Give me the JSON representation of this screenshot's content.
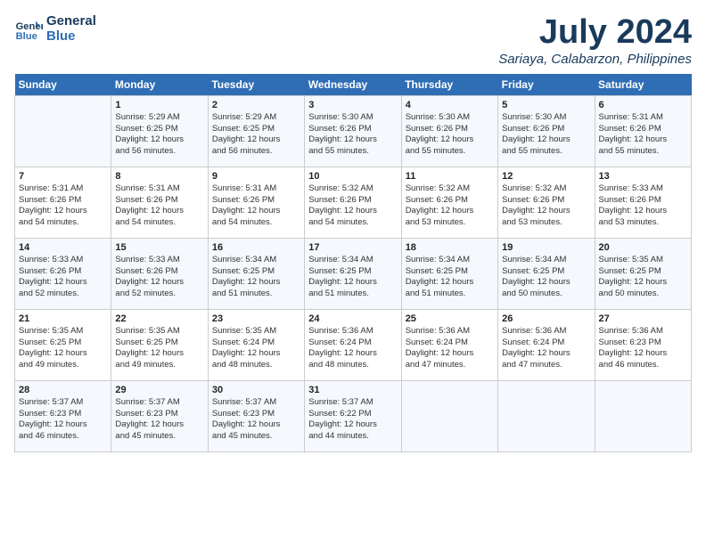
{
  "logo": {
    "line1": "General",
    "line2": "Blue"
  },
  "title": "July 2024",
  "location": "Sariaya, Calabarzon, Philippines",
  "header_days": [
    "Sunday",
    "Monday",
    "Tuesday",
    "Wednesday",
    "Thursday",
    "Friday",
    "Saturday"
  ],
  "weeks": [
    [
      {
        "day": "",
        "detail": ""
      },
      {
        "day": "1",
        "detail": "Sunrise: 5:29 AM\nSunset: 6:25 PM\nDaylight: 12 hours\nand 56 minutes."
      },
      {
        "day": "2",
        "detail": "Sunrise: 5:29 AM\nSunset: 6:25 PM\nDaylight: 12 hours\nand 56 minutes."
      },
      {
        "day": "3",
        "detail": "Sunrise: 5:30 AM\nSunset: 6:26 PM\nDaylight: 12 hours\nand 55 minutes."
      },
      {
        "day": "4",
        "detail": "Sunrise: 5:30 AM\nSunset: 6:26 PM\nDaylight: 12 hours\nand 55 minutes."
      },
      {
        "day": "5",
        "detail": "Sunrise: 5:30 AM\nSunset: 6:26 PM\nDaylight: 12 hours\nand 55 minutes."
      },
      {
        "day": "6",
        "detail": "Sunrise: 5:31 AM\nSunset: 6:26 PM\nDaylight: 12 hours\nand 55 minutes."
      }
    ],
    [
      {
        "day": "7",
        "detail": "Sunrise: 5:31 AM\nSunset: 6:26 PM\nDaylight: 12 hours\nand 54 minutes."
      },
      {
        "day": "8",
        "detail": "Sunrise: 5:31 AM\nSunset: 6:26 PM\nDaylight: 12 hours\nand 54 minutes."
      },
      {
        "day": "9",
        "detail": "Sunrise: 5:31 AM\nSunset: 6:26 PM\nDaylight: 12 hours\nand 54 minutes."
      },
      {
        "day": "10",
        "detail": "Sunrise: 5:32 AM\nSunset: 6:26 PM\nDaylight: 12 hours\nand 54 minutes."
      },
      {
        "day": "11",
        "detail": "Sunrise: 5:32 AM\nSunset: 6:26 PM\nDaylight: 12 hours\nand 53 minutes."
      },
      {
        "day": "12",
        "detail": "Sunrise: 5:32 AM\nSunset: 6:26 PM\nDaylight: 12 hours\nand 53 minutes."
      },
      {
        "day": "13",
        "detail": "Sunrise: 5:33 AM\nSunset: 6:26 PM\nDaylight: 12 hours\nand 53 minutes."
      }
    ],
    [
      {
        "day": "14",
        "detail": "Sunrise: 5:33 AM\nSunset: 6:26 PM\nDaylight: 12 hours\nand 52 minutes."
      },
      {
        "day": "15",
        "detail": "Sunrise: 5:33 AM\nSunset: 6:26 PM\nDaylight: 12 hours\nand 52 minutes."
      },
      {
        "day": "16",
        "detail": "Sunrise: 5:34 AM\nSunset: 6:25 PM\nDaylight: 12 hours\nand 51 minutes."
      },
      {
        "day": "17",
        "detail": "Sunrise: 5:34 AM\nSunset: 6:25 PM\nDaylight: 12 hours\nand 51 minutes."
      },
      {
        "day": "18",
        "detail": "Sunrise: 5:34 AM\nSunset: 6:25 PM\nDaylight: 12 hours\nand 51 minutes."
      },
      {
        "day": "19",
        "detail": "Sunrise: 5:34 AM\nSunset: 6:25 PM\nDaylight: 12 hours\nand 50 minutes."
      },
      {
        "day": "20",
        "detail": "Sunrise: 5:35 AM\nSunset: 6:25 PM\nDaylight: 12 hours\nand 50 minutes."
      }
    ],
    [
      {
        "day": "21",
        "detail": "Sunrise: 5:35 AM\nSunset: 6:25 PM\nDaylight: 12 hours\nand 49 minutes."
      },
      {
        "day": "22",
        "detail": "Sunrise: 5:35 AM\nSunset: 6:25 PM\nDaylight: 12 hours\nand 49 minutes."
      },
      {
        "day": "23",
        "detail": "Sunrise: 5:35 AM\nSunset: 6:24 PM\nDaylight: 12 hours\nand 48 minutes."
      },
      {
        "day": "24",
        "detail": "Sunrise: 5:36 AM\nSunset: 6:24 PM\nDaylight: 12 hours\nand 48 minutes."
      },
      {
        "day": "25",
        "detail": "Sunrise: 5:36 AM\nSunset: 6:24 PM\nDaylight: 12 hours\nand 47 minutes."
      },
      {
        "day": "26",
        "detail": "Sunrise: 5:36 AM\nSunset: 6:24 PM\nDaylight: 12 hours\nand 47 minutes."
      },
      {
        "day": "27",
        "detail": "Sunrise: 5:36 AM\nSunset: 6:23 PM\nDaylight: 12 hours\nand 46 minutes."
      }
    ],
    [
      {
        "day": "28",
        "detail": "Sunrise: 5:37 AM\nSunset: 6:23 PM\nDaylight: 12 hours\nand 46 minutes."
      },
      {
        "day": "29",
        "detail": "Sunrise: 5:37 AM\nSunset: 6:23 PM\nDaylight: 12 hours\nand 45 minutes."
      },
      {
        "day": "30",
        "detail": "Sunrise: 5:37 AM\nSunset: 6:23 PM\nDaylight: 12 hours\nand 45 minutes."
      },
      {
        "day": "31",
        "detail": "Sunrise: 5:37 AM\nSunset: 6:22 PM\nDaylight: 12 hours\nand 44 minutes."
      },
      {
        "day": "",
        "detail": ""
      },
      {
        "day": "",
        "detail": ""
      },
      {
        "day": "",
        "detail": ""
      }
    ]
  ]
}
